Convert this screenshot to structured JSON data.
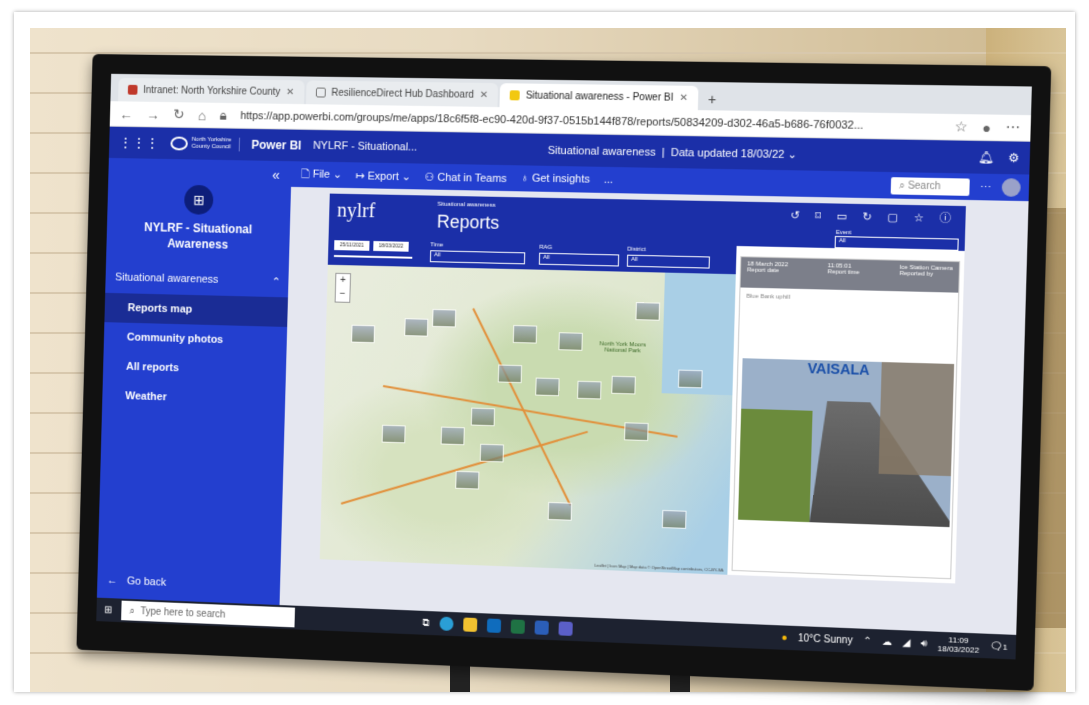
{
  "browser": {
    "tabs": [
      {
        "label": "Intranet: North Yorkshire County"
      },
      {
        "label": "ResilienceDirect Hub Dashboard"
      },
      {
        "label": "Situational awareness - Power BI"
      }
    ],
    "url": "https://app.powerbi.com/groups/me/apps/18c6f5f8-ec90-420d-9f37-0515b144f878/reports/50834209-d302-46a5-b686-76f0032..."
  },
  "header": {
    "org_logo_line1": "North Yorkshire",
    "org_logo_line2": "County Council",
    "product": "Power BI",
    "workspace": "NYLRF - Situational...",
    "report_title": "Situational awareness",
    "updated": "Data updated 18/03/22"
  },
  "sidebar": {
    "app_name": "NYLRF - Situational Awareness",
    "section": "Situational awareness",
    "items": [
      {
        "label": "Reports map"
      },
      {
        "label": "Community photos"
      },
      {
        "label": "All reports"
      },
      {
        "label": "Weather"
      }
    ],
    "go_back": "Go back"
  },
  "toolbar": {
    "file": "File",
    "export": "Export",
    "chat": "Chat in Teams",
    "insights": "Get insights",
    "more": "...",
    "search_placeholder": "Search"
  },
  "report": {
    "logo": "nylrf",
    "subtitle": "Situational awareness",
    "title": "Reports",
    "event_label": "Event",
    "event_value": "All",
    "date_from": "25/11/2021",
    "date_to": "18/03/2022",
    "time_label": "Time",
    "time_value": "All",
    "rag_label": "RAG",
    "rag_value": "All",
    "district_label": "District",
    "district_value": "All",
    "map_attribution": "Leaflet | Icon Map | Map data © OpenStreetMap contributors, CC-BY-SA",
    "map_places": [
      "North York Moors National Park"
    ]
  },
  "camera": {
    "report_date": "18 March 2022",
    "report_date_label": "Report date",
    "report_time": "11:05:01",
    "report_time_label": "Report time",
    "reported_by": "Ice Station Camera",
    "reported_by_label": "Reported by",
    "location": "Blue Bank uphill",
    "overlay_brand": "VAISALA"
  },
  "taskbar": {
    "search_placeholder": "Type here to search",
    "weather": "10°C  Sunny",
    "time": "11:09",
    "date": "18/03/2022",
    "notifications": "1"
  },
  "colors": {
    "powerbi_blue": "#1b2fa8",
    "nav_blue": "#233fcf",
    "taskbar": "#1d2230"
  }
}
